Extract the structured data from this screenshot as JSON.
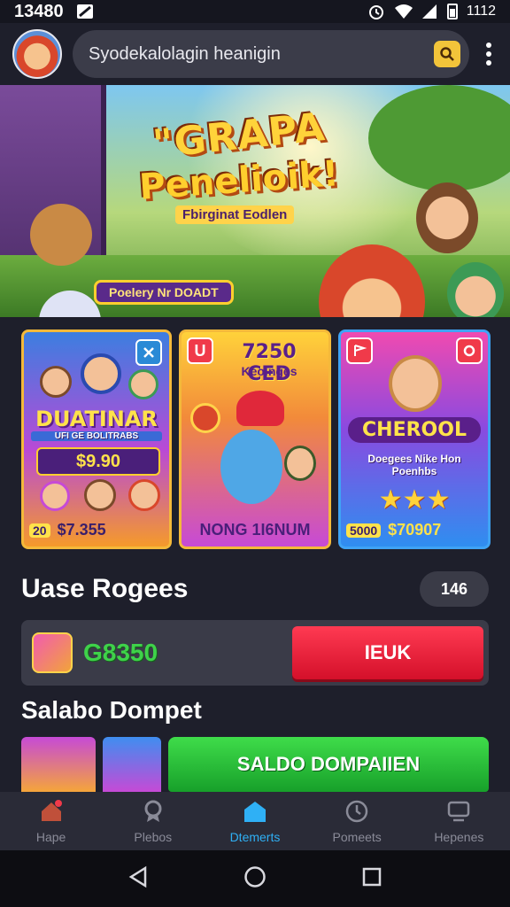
{
  "status_bar": {
    "time": "13480",
    "right_text": "1112"
  },
  "header": {
    "search_placeholder": "Syodekalolagin heanigin"
  },
  "banner": {
    "title_line1": "\"GRAPA",
    "title_line2": "Penelioik!",
    "subtitle": "Fbirginat Eodlen",
    "pill_text": "Poelery Nr DOADT"
  },
  "cards": [
    {
      "badge": "",
      "title": "DUATINAR",
      "subtitle": "UFI GE BOLITRABS",
      "price": "$9.90",
      "footer_tag": "20",
      "footer_value": "$7.355"
    },
    {
      "badge": "U",
      "title": "7250 CED",
      "subtitle": "Keoinges",
      "footer_value": "NONG 1I6NUM"
    },
    {
      "badge": "",
      "title": "CHEROOL",
      "subtitle": "Doegees Nike Hon Poenhbs",
      "footer_tag": "5000",
      "footer_value": "$70907"
    }
  ],
  "recent": {
    "title": "Uase Rogees",
    "count": "146"
  },
  "balance": {
    "value": "G8350",
    "button_label": "IEUK"
  },
  "wallet": {
    "title": "Salabo Dompet",
    "button_label": "SALDO DOMPAIIEN"
  },
  "bottom_nav": [
    {
      "label": "Hape",
      "icon": "home-icon",
      "active": false
    },
    {
      "label": "Plebos",
      "icon": "medal-icon",
      "active": false
    },
    {
      "label": "Dtemerts",
      "icon": "shop-icon",
      "active": true
    },
    {
      "label": "Pomeets",
      "icon": "clock-icon",
      "active": false
    },
    {
      "label": "Hepenes",
      "icon": "monitor-icon",
      "active": false
    }
  ],
  "colors": {
    "background": "#1e1f2b",
    "accent_red": "#ff3a52",
    "accent_green": "#3fdc4a",
    "accent_blue": "#2fb0f5",
    "accent_gold": "#ffd33a"
  }
}
